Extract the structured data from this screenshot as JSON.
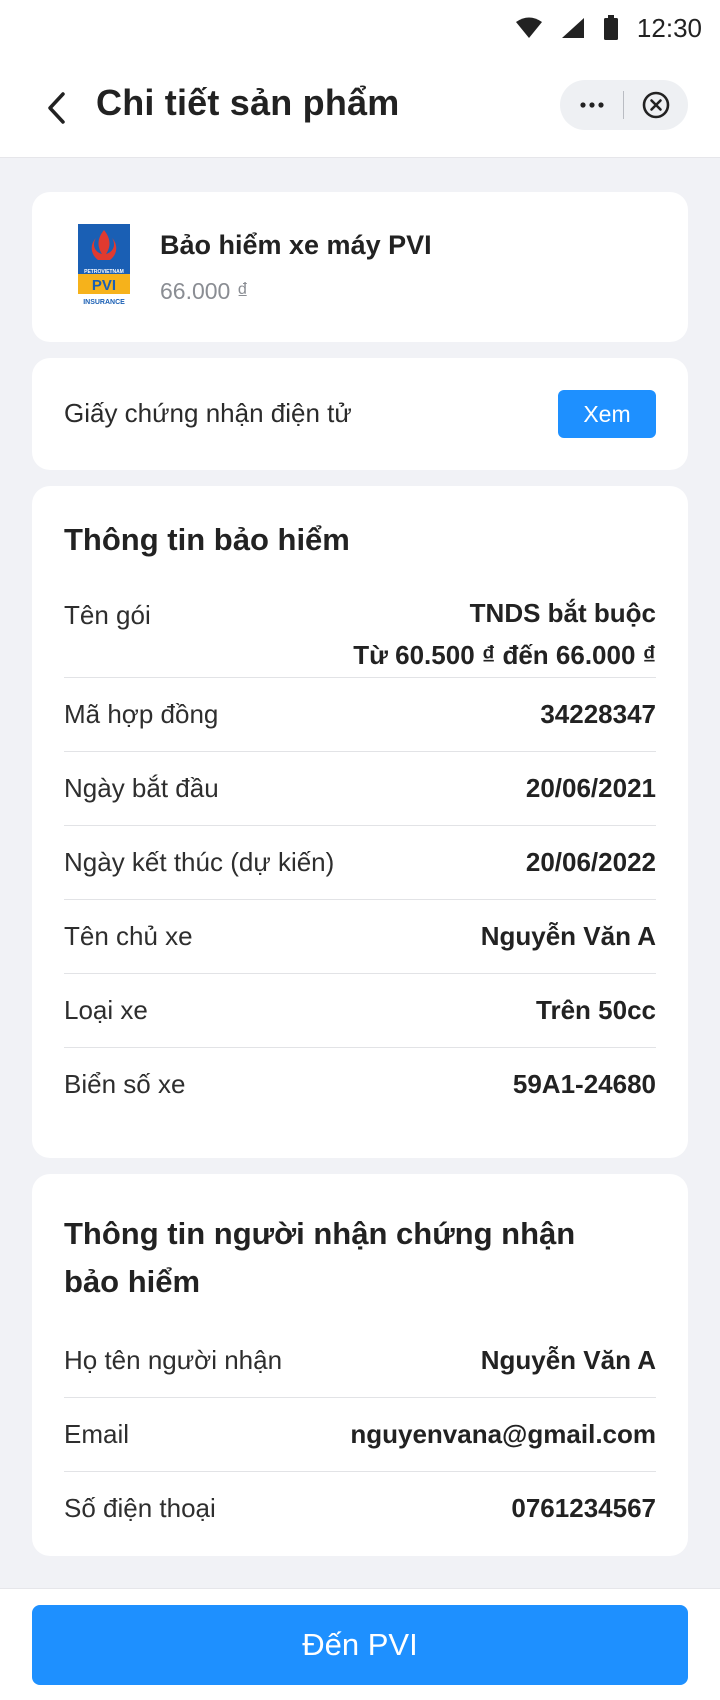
{
  "status_bar": {
    "time": "12:30",
    "icons": [
      "wifi-icon",
      "signal-icon",
      "battery-icon"
    ]
  },
  "header": {
    "title": "Chi tiết sản phẩm",
    "back_icon": "chevron-left-icon",
    "more_icon": "more-dots-icon",
    "close_icon": "close-circle-icon"
  },
  "product": {
    "name": "Bảo hiểm xe máy PVI",
    "price": "66.000 ₫",
    "logo": {
      "top_text": "PETROVIETNAM",
      "brand": "PVI",
      "bottom_text": "INSURANCE"
    }
  },
  "certificate": {
    "label": "Giấy chứng nhận điện tử",
    "button": "Xem"
  },
  "insurance_info": {
    "title": "Thông tin bảo hiểm",
    "rows": [
      {
        "label": "Tên gói",
        "value": "TNDS bắt buộc",
        "value2": "Từ 60.500 ₫ đến 66.000 ₫"
      },
      {
        "label": "Mã hợp đồng",
        "value": "34228347"
      },
      {
        "label": "Ngày bắt đầu",
        "value": "20/06/2021"
      },
      {
        "label": "Ngày kết thúc (dự kiến)",
        "value": "20/06/2022"
      },
      {
        "label": "Tên chủ xe",
        "value": "Nguyễn Văn A"
      },
      {
        "label": "Loại xe",
        "value": "Trên 50cc"
      },
      {
        "label": "Biển số xe",
        "value": "59A1-24680"
      }
    ]
  },
  "recipient_info": {
    "title_line1": "Thông tin người nhận chứng nhận",
    "title_line2": "bảo hiểm",
    "rows": [
      {
        "label": "Họ tên người nhận",
        "value": "Nguyễn Văn A"
      },
      {
        "label": "Email",
        "value": "nguyenvana@gmail.com"
      },
      {
        "label": "Số điện thoại",
        "value": "0761234567"
      }
    ]
  },
  "footer": {
    "button": "Đến PVI"
  },
  "colors": {
    "accent": "#1e90ff",
    "background": "#f1f2f6",
    "card": "#ffffff",
    "muted_text": "#8a8d93"
  }
}
